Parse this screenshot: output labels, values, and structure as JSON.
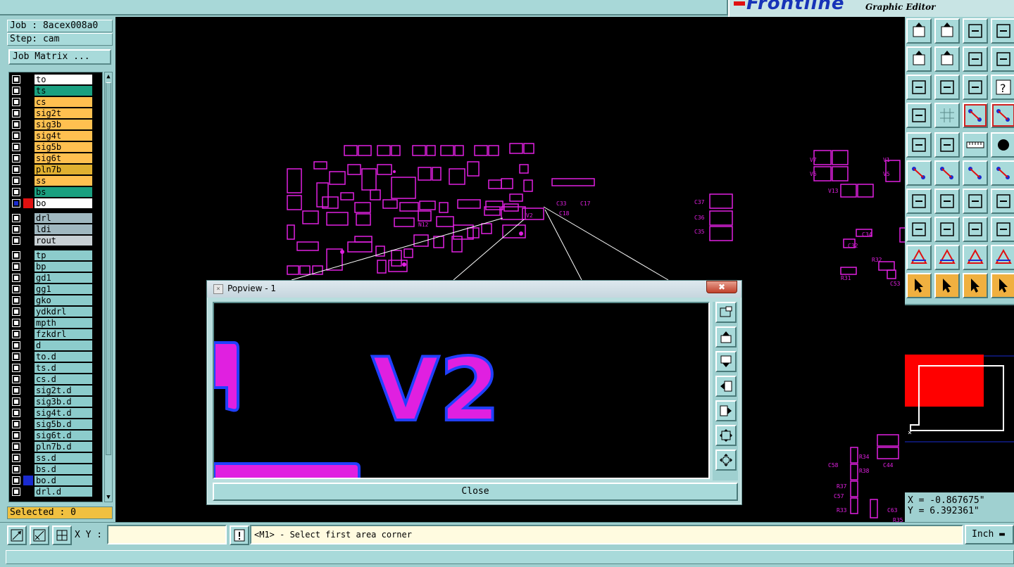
{
  "brand": {
    "logo": "Frontline",
    "subtitle": "Graphic Editor"
  },
  "job": {
    "job_label": "Job : 8acex008a0",
    "step_label": "Step: cam",
    "job_matrix_button": "Job Matrix ..."
  },
  "layers": [
    {
      "name": "to",
      "bg": "#ffffff",
      "mark": "✎",
      "checked": false,
      "color": ""
    },
    {
      "name": "ts",
      "bg": "#1aa080",
      "mark": "",
      "checked": false,
      "color": ""
    },
    {
      "name": "cs",
      "bg": "#ffc050",
      "mark": "",
      "checked": false,
      "color": ""
    },
    {
      "name": "sig2t",
      "bg": "#ffc050",
      "mark": "",
      "checked": false,
      "color": ""
    },
    {
      "name": "sig3b",
      "bg": "#ffc050",
      "mark": "",
      "checked": false,
      "color": ""
    },
    {
      "name": "sig4t",
      "bg": "#ffc050",
      "mark": "",
      "checked": false,
      "color": ""
    },
    {
      "name": "sig5b",
      "bg": "#ffc050",
      "mark": "",
      "checked": false,
      "color": ""
    },
    {
      "name": "sig6t",
      "bg": "#ffc050",
      "mark": "",
      "checked": false,
      "color": ""
    },
    {
      "name": "pln7b",
      "bg": "#e0b030",
      "mark": "",
      "checked": false,
      "color": ""
    },
    {
      "name": "ss",
      "bg": "#ffc050",
      "mark": "",
      "checked": false,
      "color": ""
    },
    {
      "name": "bs",
      "bg": "#1aa080",
      "mark": "",
      "checked": false,
      "color": ""
    },
    {
      "name": "bo",
      "bg": "#ffffff",
      "mark": "✎⊞",
      "checked": true,
      "color": "#e01010"
    },
    {
      "name": "drl",
      "bg": "#a0b8c0",
      "mark": "",
      "checked": false,
      "color": "",
      "gap": true
    },
    {
      "name": "ldi",
      "bg": "#a0b8c0",
      "mark": "",
      "checked": false,
      "color": ""
    },
    {
      "name": "rout",
      "bg": "#c8d0d4",
      "mark": "",
      "checked": false,
      "color": ""
    },
    {
      "name": "tp",
      "bg": "#8ccccc",
      "mark": "",
      "checked": false,
      "color": "",
      "gap": true
    },
    {
      "name": "bp",
      "bg": "#8ccccc",
      "mark": "",
      "checked": false,
      "color": ""
    },
    {
      "name": "gd1",
      "bg": "#8ccccc",
      "mark": "✎",
      "checked": false,
      "color": ""
    },
    {
      "name": "gg1",
      "bg": "#8ccccc",
      "mark": "",
      "checked": false,
      "color": ""
    },
    {
      "name": "gko",
      "bg": "#8ccccc",
      "mark": "✎",
      "checked": false,
      "color": ""
    },
    {
      "name": "ydkdrl",
      "bg": "#8ccccc",
      "mark": "",
      "checked": false,
      "color": ""
    },
    {
      "name": "mpth",
      "bg": "#8ccccc",
      "mark": "",
      "checked": false,
      "color": ""
    },
    {
      "name": "fzkdrl",
      "bg": "#8ccccc",
      "mark": "",
      "checked": false,
      "color": ""
    },
    {
      "name": "d",
      "bg": "#8ccccc",
      "mark": "",
      "checked": false,
      "color": ""
    },
    {
      "name": "to.d",
      "bg": "#8ccccc",
      "mark": "✎",
      "checked": false,
      "color": ""
    },
    {
      "name": "ts.d",
      "bg": "#8ccccc",
      "mark": "",
      "checked": false,
      "color": ""
    },
    {
      "name": "cs.d",
      "bg": "#8ccccc",
      "mark": "",
      "checked": false,
      "color": ""
    },
    {
      "name": "sig2t.d",
      "bg": "#8ccccc",
      "mark": "",
      "checked": false,
      "color": ""
    },
    {
      "name": "sig3b.d",
      "bg": "#8ccccc",
      "mark": "",
      "checked": false,
      "color": ""
    },
    {
      "name": "sig4t.d",
      "bg": "#8ccccc",
      "mark": "",
      "checked": false,
      "color": ""
    },
    {
      "name": "sig5b.d",
      "bg": "#8ccccc",
      "mark": "",
      "checked": false,
      "color": ""
    },
    {
      "name": "sig6t.d",
      "bg": "#8ccccc",
      "mark": "",
      "checked": false,
      "color": ""
    },
    {
      "name": "pln7b.d",
      "bg": "#8ccccc",
      "mark": "",
      "checked": false,
      "color": ""
    },
    {
      "name": "ss.d",
      "bg": "#8ccccc",
      "mark": "",
      "checked": false,
      "color": ""
    },
    {
      "name": "bs.d",
      "bg": "#8ccccc",
      "mark": "",
      "checked": false,
      "color": ""
    },
    {
      "name": "bo.d",
      "bg": "#8ccccc",
      "mark": "✎",
      "checked": false,
      "color": "#1a2bd0"
    },
    {
      "name": "drl.d",
      "bg": "#8ccccc",
      "mark": "",
      "checked": false,
      "color": ""
    }
  ],
  "selected_label": "Selected : 0",
  "popview": {
    "title": "Popview - 1",
    "close_x": "✖",
    "close_button": "Close",
    "preview_text": "V2"
  },
  "coords": {
    "x": "X = -0.867675\"",
    "y": "Y = 6.392361\""
  },
  "bottom": {
    "xy_label": "X Y :",
    "xy_value": "",
    "prompt": "<M1> - Select first area corner",
    "units": "Inch"
  },
  "colors": {
    "trace": "#e020e0",
    "outline": "#2040ff",
    "panel": "#9fd0d0",
    "highlight": "#f0b040"
  }
}
